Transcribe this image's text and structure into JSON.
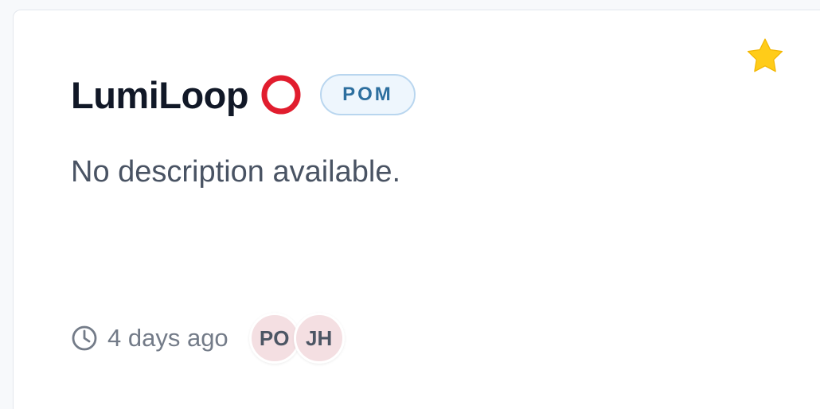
{
  "card": {
    "title": "LumiLoop",
    "tag": "POM",
    "description": "No description available.",
    "updated": "4 days ago",
    "avatars": [
      "PO",
      "JH"
    ]
  },
  "colors": {
    "star": "#ffcc19",
    "status_ring": "#e11d2e",
    "tag_border": "#b9d6ef",
    "tag_background": "#eef6fd",
    "avatar_background": "#f4dfe2"
  },
  "icons": {
    "favorite": "star-icon",
    "status": "red-ring-icon",
    "time": "clock-icon"
  }
}
